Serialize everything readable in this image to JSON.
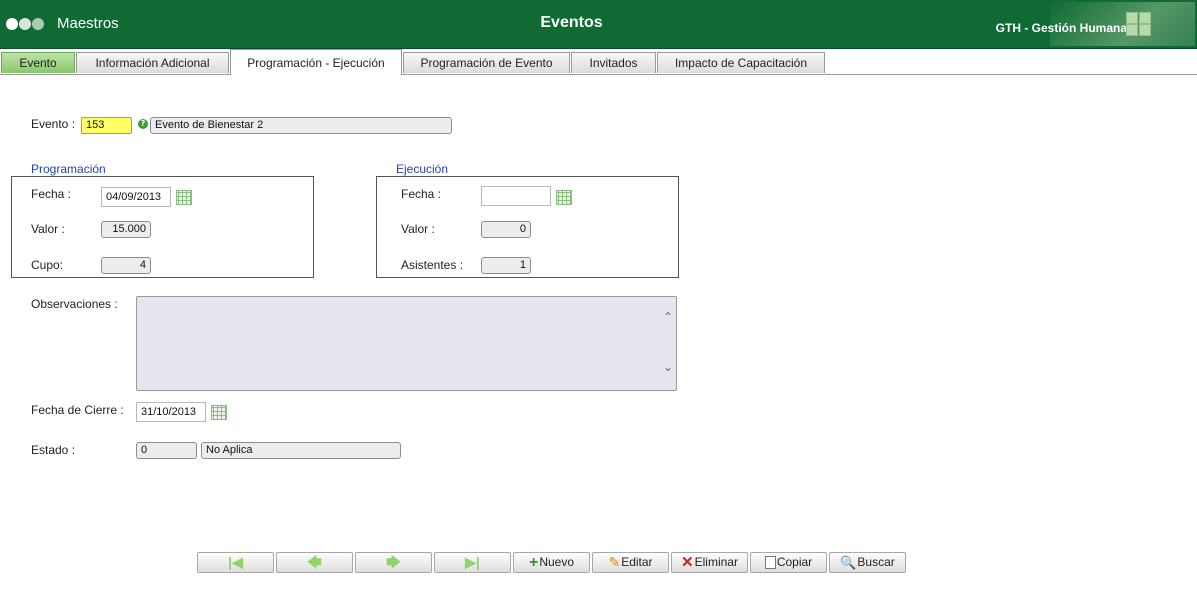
{
  "header": {
    "module": "Maestros",
    "title": "Eventos",
    "brand": "GTH - Gestión Humana"
  },
  "tabs": [
    {
      "label": "Evento"
    },
    {
      "label": "Información Adicional"
    },
    {
      "label": "Programación - Ejecución"
    },
    {
      "label": "Programación de Evento"
    },
    {
      "label": "Invitados"
    },
    {
      "label": "Impacto de Capacitación"
    }
  ],
  "evento": {
    "label": "Evento :",
    "code": "153",
    "name": "Evento de Bienestar 2"
  },
  "programacion": {
    "title": "Programación",
    "fecha_label": "Fecha :",
    "fecha": "04/09/2013",
    "valor_label": "Valor :",
    "valor": "15.000",
    "cupo_label": "Cupo:",
    "cupo": "4"
  },
  "ejecucion": {
    "title": "Ejecución",
    "fecha_label": "Fecha :",
    "fecha": "",
    "valor_label": "Valor :",
    "valor": "0",
    "asistentes_label": "Asistentes :",
    "asistentes": "1"
  },
  "observaciones": {
    "label": "Observaciones :",
    "value": ""
  },
  "cierre": {
    "label": "Fecha de Cierre :",
    "value": "31/10/2013"
  },
  "estado": {
    "label": "Estado :",
    "code": "0",
    "name": "No Aplica"
  },
  "toolbar": {
    "nuevo": "Nuevo",
    "editar": "Editar",
    "eliminar": "Eliminar",
    "copiar": "Copiar",
    "buscar": "Buscar"
  },
  "colors": {
    "header": "#0f6b33",
    "tab_green": "#88c86b",
    "section_title": "#2244aa",
    "highlight_field": "#ffff66"
  }
}
